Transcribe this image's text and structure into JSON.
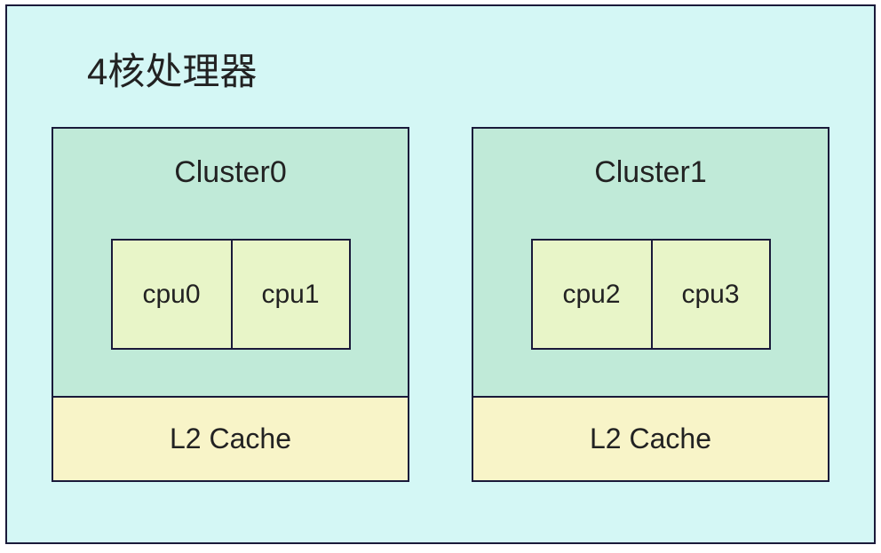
{
  "title": "4核处理器",
  "clusters": [
    {
      "label": "Cluster0",
      "cpus": [
        "cpu0",
        "cpu1"
      ],
      "cache": "L2 Cache"
    },
    {
      "label": "Cluster1",
      "cpus": [
        "cpu2",
        "cpu3"
      ],
      "cache": "L2 Cache"
    }
  ]
}
